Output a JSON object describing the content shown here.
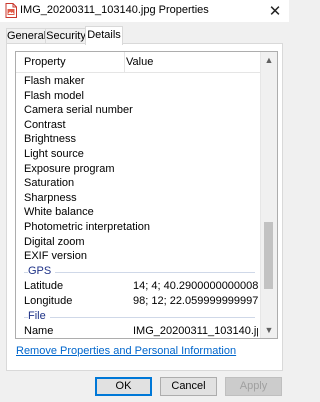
{
  "window": {
    "title": "IMG_20200311_103140.jpg Properties",
    "icon": "image-file-icon",
    "close_glyph": "✕"
  },
  "tabs": [
    {
      "label": "General",
      "active": false
    },
    {
      "label": "Security",
      "active": false
    },
    {
      "label": "Details",
      "active": true
    }
  ],
  "details": {
    "columns": {
      "property": "Property",
      "value": "Value"
    },
    "rows_top": [
      {
        "property": "Flash maker",
        "value": ""
      },
      {
        "property": "Flash model",
        "value": ""
      },
      {
        "property": "Camera serial number",
        "value": ""
      },
      {
        "property": "Contrast",
        "value": ""
      },
      {
        "property": "Brightness",
        "value": ""
      },
      {
        "property": "Light source",
        "value": ""
      },
      {
        "property": "Exposure program",
        "value": ""
      },
      {
        "property": "Saturation",
        "value": ""
      },
      {
        "property": "Sharpness",
        "value": ""
      },
      {
        "property": "White balance",
        "value": ""
      },
      {
        "property": "Photometric interpretation",
        "value": ""
      },
      {
        "property": "Digital zoom",
        "value": ""
      },
      {
        "property": "EXIF version",
        "value": ""
      }
    ],
    "group_gps": "GPS",
    "rows_gps": [
      {
        "property": "Latitude",
        "value": "14; 4; 40.29000000000085..."
      },
      {
        "property": "Longitude",
        "value": "98; 12; 22.0599999999976..."
      }
    ],
    "group_file": "File",
    "rows_file": [
      {
        "property": "Name",
        "value": "IMG_20200311_103140.jpg"
      }
    ]
  },
  "scrollbar": {
    "up_glyph": "▲",
    "down_glyph": "▼"
  },
  "remove_link": "Remove Properties and Personal Information",
  "buttons": {
    "ok": "OK",
    "cancel": "Cancel",
    "apply": "Apply"
  },
  "colors": {
    "link": "#0066cc",
    "group_header": "#1e3287",
    "focus_border": "#0078d7"
  }
}
